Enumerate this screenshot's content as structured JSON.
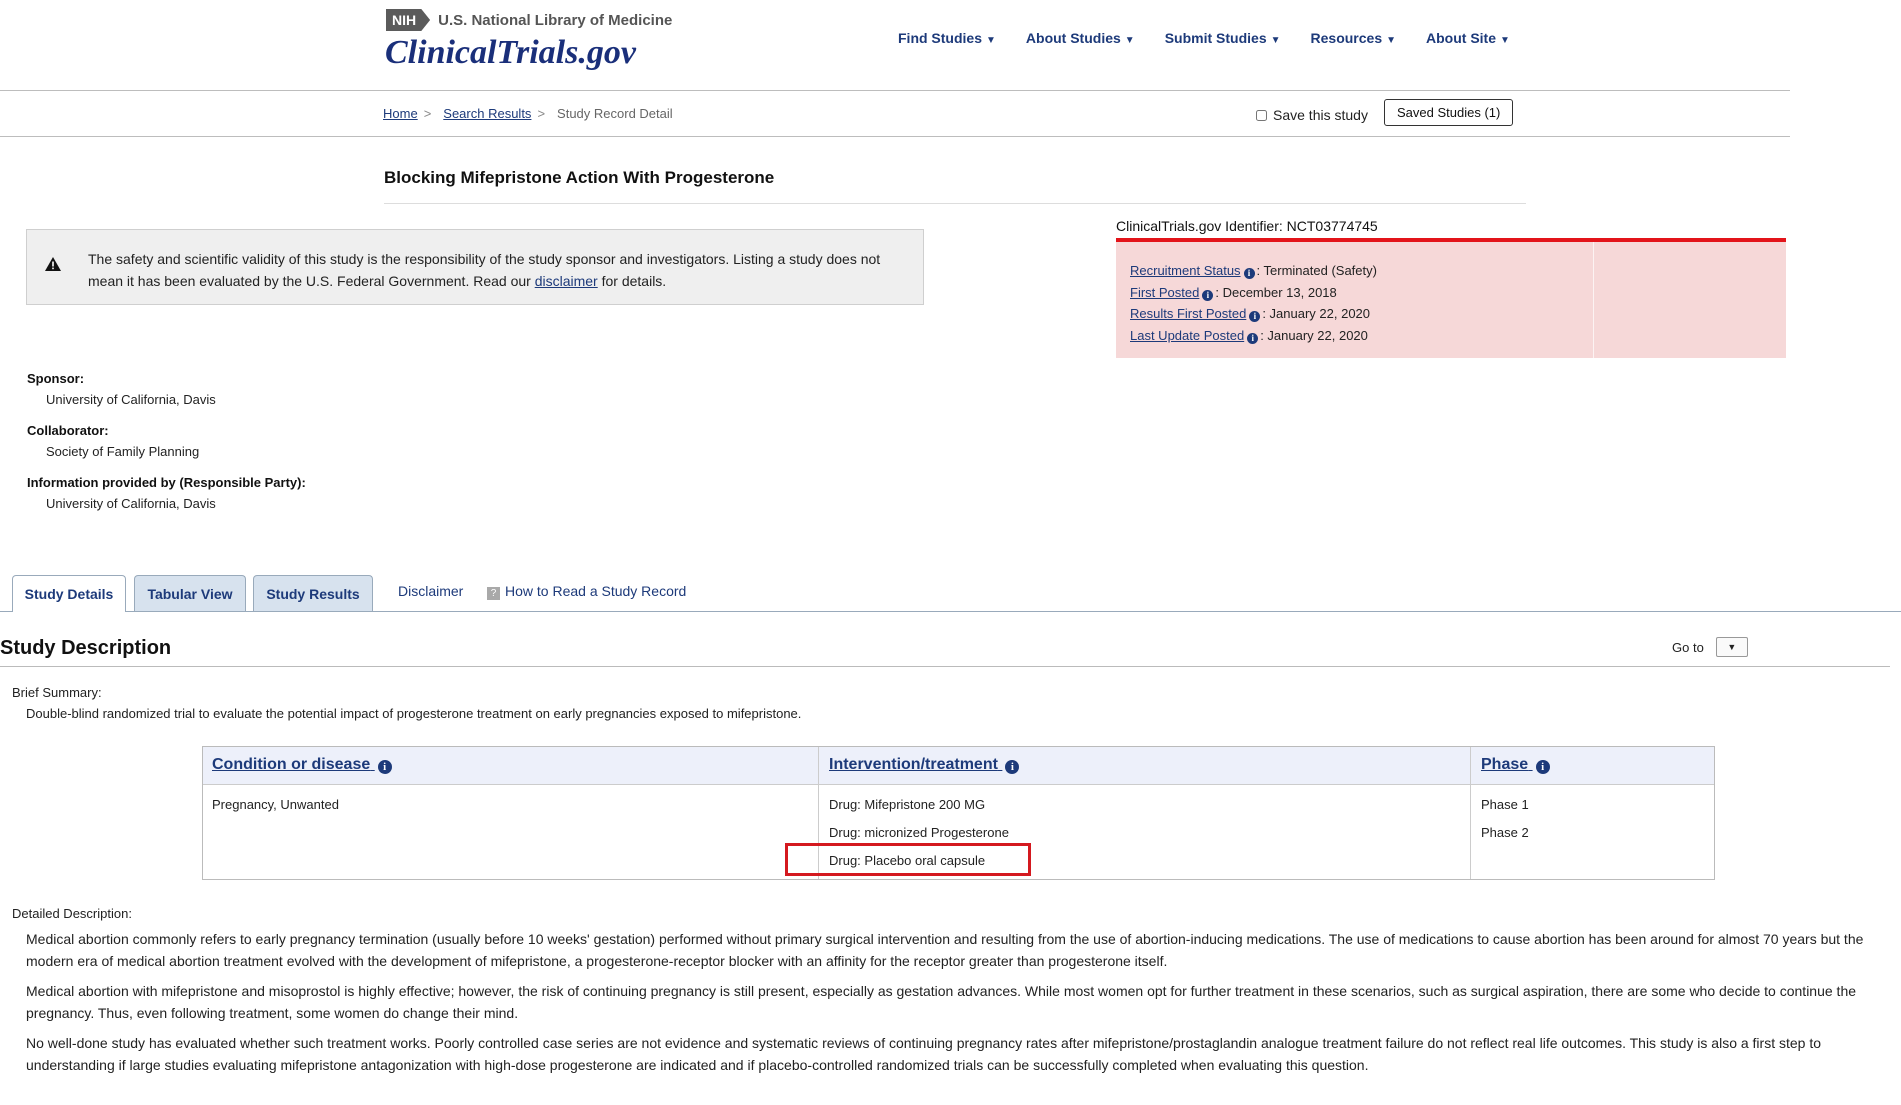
{
  "header": {
    "nih_badge": "NIH",
    "nlm_text": "U.S. National Library of Medicine",
    "site_title": "ClinicalTrials.gov",
    "nav": [
      {
        "label": "Find Studies"
      },
      {
        "label": "About Studies"
      },
      {
        "label": "Submit Studies"
      },
      {
        "label": "Resources"
      },
      {
        "label": "About Site"
      }
    ]
  },
  "breadcrumb": {
    "home": "Home",
    "sep": ">",
    "search_results": "Search Results",
    "current": "Study Record Detail"
  },
  "save_study": {
    "label": "Save this study",
    "checked": false,
    "saved_button": "Saved Studies (1)"
  },
  "study": {
    "title": "Blocking Mifepristone Action With Progesterone",
    "identifier": "ClinicalTrials.gov Identifier: NCT03774745",
    "status": [
      {
        "label": "Recruitment Status",
        "value": ": Terminated (Safety)"
      },
      {
        "label": "First Posted",
        "value": ": December 13, 2018"
      },
      {
        "label": "Results First Posted",
        "value": ": January 22, 2020"
      },
      {
        "label": "Last Update Posted",
        "value": ": January 22, 2020"
      }
    ]
  },
  "disclaimer": {
    "text_before": "The safety and scientific validity of this study is the responsibility of the study sponsor and investigators. Listing a study does not mean it has been evaluated by the U.S. Federal Government. Read our ",
    "link": "disclaimer",
    "text_after": " for details."
  },
  "sponsor": {
    "sponsor_label": "Sponsor:",
    "sponsor_value": "University of California, Davis",
    "collaborator_label": "Collaborator:",
    "collaborator_value": "Society of Family Planning",
    "info_label": "Information provided by (Responsible Party):",
    "info_value": "University of California, Davis"
  },
  "tabs": {
    "study_details": "Study Details",
    "tabular_view": "Tabular View",
    "study_results": "Study Results",
    "disclaimer": "Disclaimer",
    "how_to_read": "How to Read a Study Record",
    "help_icon": "?"
  },
  "description": {
    "heading": "Study Description",
    "goto_label": "Go to",
    "brief_label": "Brief Summary:",
    "brief_text": "Double-blind randomized trial to evaluate the potential impact of progesterone treatment on early pregnancies exposed to mifepristone.",
    "table": {
      "headers": [
        "Condition or disease",
        "Intervention/treatment",
        "Phase"
      ],
      "conditions": [
        "Pregnancy, Unwanted"
      ],
      "interventions": [
        "Drug: Mifepristone 200 MG",
        "Drug: micronized Progesterone",
        "Drug: Placebo oral capsule"
      ],
      "phases": [
        "Phase 1",
        "Phase 2"
      ]
    },
    "detailed_label": "Detailed Description:",
    "paragraphs": [
      "Medical abortion commonly refers to early pregnancy termination (usually before 10 weeks' gestation) performed without primary surgical intervention and resulting from the use of abortion-inducing medications. The use of medications to cause abortion has been around for almost 70 years but the modern era of medical abortion treatment evolved with the development of mifepristone, a progesterone-receptor blocker with an affinity for the receptor greater than progesterone itself.",
      "Medical abortion with mifepristone and misoprostol is highly effective; however, the risk of continuing pregnancy is still present, especially as gestation advances. While most women opt for further treatment in these scenarios, such as surgical aspiration, there are some who decide to continue the pregnancy. Thus, even following treatment, some women do change their mind.",
      "No well-done study has evaluated whether such treatment works. Poorly controlled case series are not evidence and systematic reviews of continuing pregnancy rates after mifepristone/prostaglandin analogue treatment failure do not reflect real life outcomes. This study is also a first step to understanding if large studies evaluating mifepristone antagonization with high-dose progesterone are indicated and if placebo-controlled randomized trials can be successfully completed when evaluating this question."
    ]
  },
  "icons": {
    "warning": "warning-triangle-icon",
    "info": "info-icon",
    "caret": "caret-down-icon",
    "help": "help-icon"
  },
  "colors": {
    "brand_blue": "#1a2f7a",
    "link_blue": "#1d3a7a",
    "status_red": "#e3141a",
    "status_bg": "#f6d8d8",
    "highlight_red": "#d4191f"
  }
}
